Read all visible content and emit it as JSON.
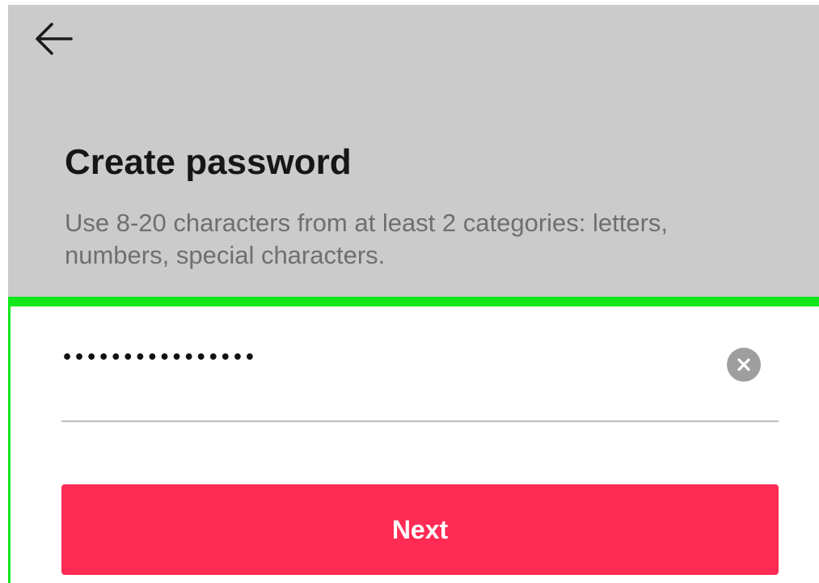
{
  "header": {
    "back_icon": "arrow-left-icon"
  },
  "content": {
    "title": "Create password",
    "subtitle": "Use 8-20 characters from at least 2 categories: letters, numbers, special characters."
  },
  "form": {
    "password_value": "••••••••••••••••",
    "clear_icon": "close-circle-icon"
  },
  "actions": {
    "next_label": "Next"
  },
  "colors": {
    "dim_overlay": "#cbcbcb",
    "accent": "#fe2c55",
    "highlight_border": "#10e81a",
    "title_text": "#161616",
    "subtitle_text": "#6f6f6f"
  }
}
